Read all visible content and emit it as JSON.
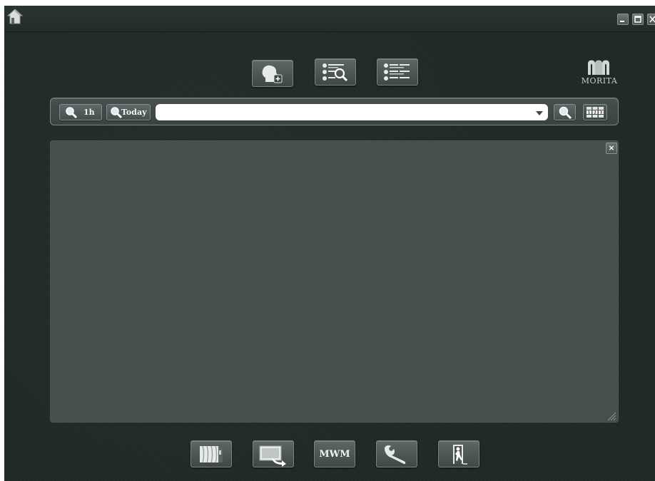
{
  "titlebar": {
    "icons": {
      "home": "home-icon",
      "minimize": "minimize-icon",
      "maximize": "maximize-icon",
      "close": "close-icon"
    }
  },
  "toolbar_top": {
    "buttons": [
      {
        "id": "new-patient",
        "icon": "new-patient-head-icon"
      },
      {
        "id": "patient-search",
        "icon": "patient-list-search-icon"
      },
      {
        "id": "patient-list",
        "icon": "patient-list-icon"
      }
    ]
  },
  "logo": {
    "text": "MORITA",
    "icon": "morita-logo-icon"
  },
  "search": {
    "btn_1h": "1h",
    "btn_today": "Today",
    "input_value": "",
    "input_placeholder": "",
    "icons": {
      "magnifier": "magnifier-icon",
      "dropdown": "dropdown-arrow-icon",
      "grid": "number-grid-icon"
    },
    "grid_digits": [
      "1",
      "2",
      "3"
    ]
  },
  "panel": {
    "close_label": "×"
  },
  "toolbar_bottom": {
    "mwm_label": "MWM",
    "buttons": [
      {
        "id": "film",
        "icon": "film-icon"
      },
      {
        "id": "import-image",
        "icon": "import-image-icon"
      },
      {
        "id": "mwm",
        "icon": "mwm-text"
      },
      {
        "id": "settings",
        "icon": "wrench-icon"
      },
      {
        "id": "exit",
        "icon": "exit-door-icon"
      }
    ]
  },
  "colors": {
    "background": "#1f2a28",
    "panel": "#454f4d",
    "button": "#4f5958",
    "button_border": "#7b8483",
    "text": "#f2f4f4"
  }
}
